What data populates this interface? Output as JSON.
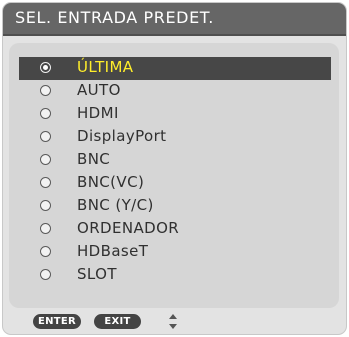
{
  "dialog": {
    "title": "SEL. ENTRADA PREDET."
  },
  "options": [
    {
      "label": "ÚLTIMA",
      "selected": true
    },
    {
      "label": "AUTO",
      "selected": false
    },
    {
      "label": "HDMI",
      "selected": false
    },
    {
      "label": "DisplayPort",
      "selected": false
    },
    {
      "label": "BNC",
      "selected": false
    },
    {
      "label": "BNC(VC)",
      "selected": false
    },
    {
      "label": "BNC (Y/C)",
      "selected": false
    },
    {
      "label": "ORDENADOR",
      "selected": false
    },
    {
      "label": "HDBaseT",
      "selected": false
    },
    {
      "label": "SLOT",
      "selected": false
    }
  ],
  "footer": {
    "enter_label": "ENTER",
    "exit_label": "EXIT",
    "nav_icon": "up-down-arrows-icon"
  },
  "colors": {
    "title_bar": "#666666",
    "panel_bg": "#e3e3e3",
    "list_bg": "#d6d6d6",
    "selected_row": "#474747",
    "selected_text": "#ffee2a",
    "key_button": "#444444"
  }
}
